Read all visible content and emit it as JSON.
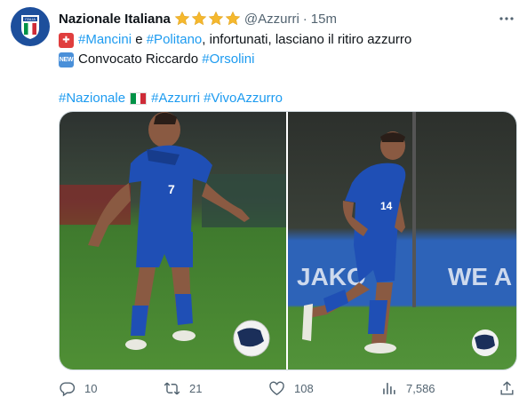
{
  "tweet": {
    "display_name": "Nazionale Italiana",
    "handle": "@Azzurri",
    "separator": "·",
    "time": "15m",
    "avatar_text": "ITALIA",
    "lines": {
      "l1_tag1": "#Mancini",
      "l1_and": " e ",
      "l1_tag2": "#Politano",
      "l1_rest": ", infortunati, lasciano il ritiro azzurro",
      "l2_text": "Convocato Riccardo ",
      "l2_tag": "#Orsolini",
      "l3_tag1": "#Nazionale",
      "l3_tag2": "#Azzurri",
      "l3_tag3": "#VivoAzzurro"
    },
    "emoji_new": "NEW",
    "photo1_jersey": "7",
    "photo2_jersey": "14",
    "photo2_ad": "JAKO",
    "photo2_ad2": "WE A"
  },
  "actions": {
    "replies": "10",
    "retweets": "21",
    "likes": "108",
    "views": "7,586"
  },
  "colors": {
    "link": "#1d9bf0",
    "muted": "#536471",
    "azzurro": "#1f4fb5"
  }
}
